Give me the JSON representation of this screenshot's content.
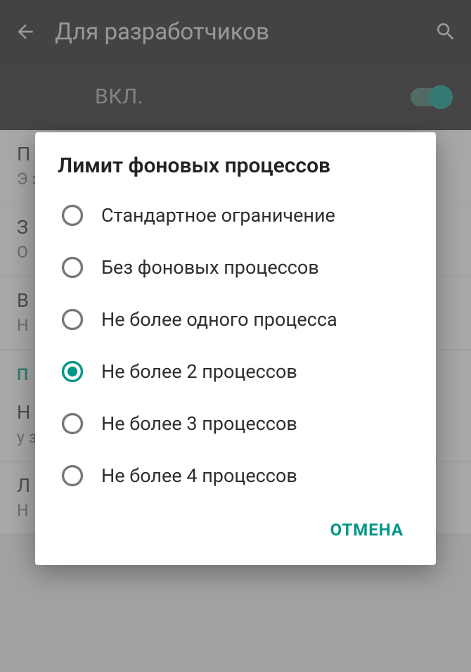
{
  "header": {
    "title": "Для разработчиков"
  },
  "toggle": {
    "label": "ВКЛ."
  },
  "background_items": [
    {
      "primary": "П",
      "secondary": "Э\nза"
    },
    {
      "primary": "З",
      "secondary": "О"
    },
    {
      "primary": "В",
      "secondary": "Н"
    }
  ],
  "section_label": "П",
  "background_items2": [
    {
      "primary": "Н",
      "secondary": "у\nза"
    },
    {
      "primary": "Л",
      "secondary": "Н"
    }
  ],
  "dialog": {
    "title": "Лимит фоновых процессов",
    "options": [
      {
        "label": "Стандартное ограничение",
        "selected": false
      },
      {
        "label": "Без фоновых процессов",
        "selected": false
      },
      {
        "label": "Не более одного процесса",
        "selected": false
      },
      {
        "label": "Не более 2 процессов",
        "selected": true
      },
      {
        "label": "Не более 3 процессов",
        "selected": false
      },
      {
        "label": "Не более 4 процессов",
        "selected": false
      }
    ],
    "cancel": "ОТМЕНА"
  }
}
